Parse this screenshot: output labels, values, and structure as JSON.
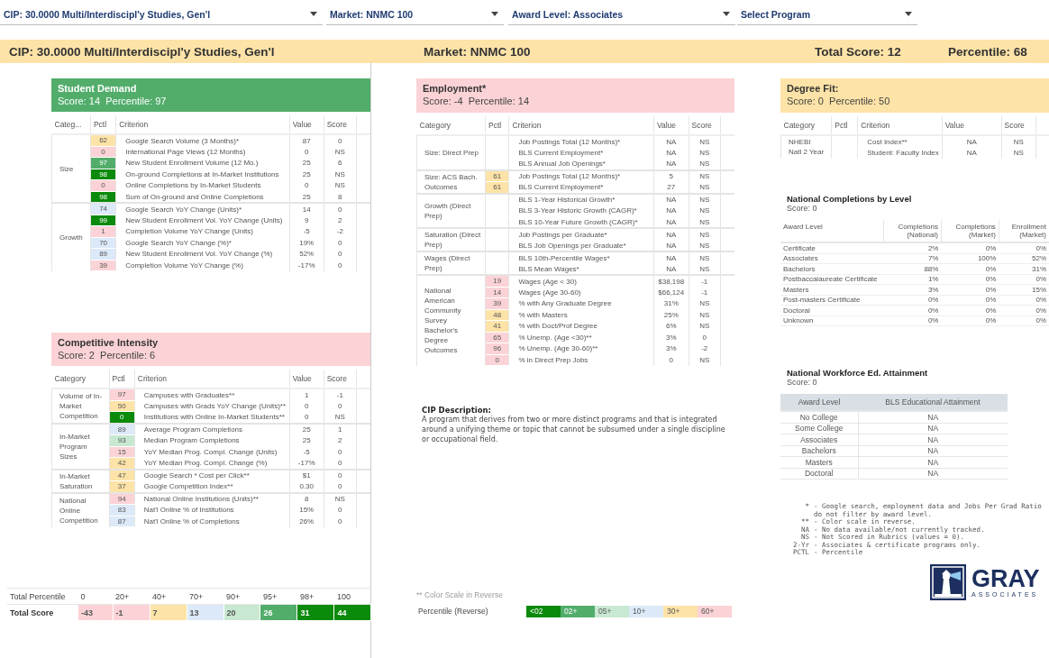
{
  "dropdowns": [
    {
      "label": "CIP: 30.0000 Multi/Interdiscipl'y Studies, Gen'l"
    },
    {
      "label": "Market: NNMC 100"
    },
    {
      "label": "Award Level: Associates"
    },
    {
      "label": "Select Program"
    }
  ],
  "summary": {
    "cip": "CIP: 30.0000 Multi/Interdiscipl'y Studies, Gen'l",
    "market": "Market: NNMC 100",
    "total_score": "Total Score: 12",
    "percentile": "Percentile: 68"
  },
  "panels": [
    {
      "title": "Student Demand",
      "subtitle": "Score: 14  Percentile: 97",
      "color": "#52ad6b",
      "columns": [
        "Categ...",
        "Pctl",
        "Criterion",
        "Value",
        "Score"
      ],
      "groups": [
        {
          "category": "Size",
          "rows": [
            {
              "pctl": "62",
              "color": "#fde3a7",
              "criterion": "Google Search Volume (3 Months)*",
              "value": "87",
              "score": "0"
            },
            {
              "pctl": "0",
              "color": "#fbd3d6",
              "criterion": "International Page Views (12 Months)",
              "value": "0",
              "score": "NS"
            },
            {
              "pctl": "97",
              "color": "#52ad6b",
              "criterion": "New Student Enrollment Volume (12 Mo.)",
              "value": "25",
              "score": "6"
            },
            {
              "pctl": "98",
              "color": "#0b8a0b",
              "criterion": "On-ground Completions at In-Market Institutions",
              "value": "25",
              "score": "NS"
            },
            {
              "pctl": "0",
              "color": "#fbd3d6",
              "criterion": "Online Completions by In-Market Students",
              "value": "0",
              "score": "NS"
            },
            {
              "pctl": "98",
              "color": "#0b8a0b",
              "criterion": "Sum of On-ground and Online Completions",
              "value": "25",
              "score": "8"
            }
          ]
        },
        {
          "category": "Growth",
          "rows": [
            {
              "pctl": "74",
              "color": "#dce9f8",
              "criterion": "Google Search YoY Change (Units)*",
              "value": "14",
              "score": "0"
            },
            {
              "pctl": "99",
              "color": "#0b8a0b",
              "criterion": "New Student Enrollment Vol. YoY Change (Units)",
              "value": "9",
              "score": "2"
            },
            {
              "pctl": "1",
              "color": "#fbd3d6",
              "criterion": "Completion Volume YoY Change (Units)",
              "value": "-5",
              "score": "-2"
            },
            {
              "pctl": "70",
              "color": "#dce9f8",
              "criterion": "Google Search YoY Change (%)*",
              "value": "19%",
              "score": "0"
            },
            {
              "pctl": "89",
              "color": "#dce9f8",
              "criterion": "New Student Enrollment Vol. YoY Change (%)",
              "value": "52%",
              "score": "0"
            },
            {
              "pctl": "39",
              "color": "#fbd3d6",
              "criterion": "Completion Volume YoY Change (%)",
              "value": "-17%",
              "score": "0"
            }
          ]
        }
      ]
    },
    {
      "title": "Competitive Intensity",
      "subtitle": "Score: 2  Percentile: 6",
      "color": "#fbd3d6",
      "columns": [
        "Category",
        "Pctl",
        "Criterion",
        "Value",
        "Score"
      ],
      "groups": [
        {
          "category": "Volume of In-Market Competition",
          "rows": [
            {
              "pctl": "97",
              "color": "#fbd3d6",
              "criterion": "Campuses with Graduates**",
              "value": "1",
              "score": "-1"
            },
            {
              "pctl": "50",
              "color": "#fde3a7",
              "criterion": "Campuses with Grads YoY Change (Units)**",
              "value": "0",
              "score": "0"
            },
            {
              "pctl": "0",
              "color": "#0b8a0b",
              "criterion": "Institutions with Online In-Market Students**",
              "value": "0",
              "score": "NS"
            }
          ]
        },
        {
          "category": "In-Market Program Sizes",
          "rows": [
            {
              "pctl": "89",
              "color": "#dce9f8",
              "criterion": "Average Program Completions",
              "value": "25",
              "score": "1"
            },
            {
              "pctl": "93",
              "color": "#c8e8d1",
              "criterion": "Median Program Completions",
              "value": "25",
              "score": "2"
            },
            {
              "pctl": "15",
              "color": "#fbd3d6",
              "criterion": "YoY Median Prog. Compl. Change (Units)",
              "value": "-5",
              "score": "0"
            },
            {
              "pctl": "42",
              "color": "#fde3a7",
              "criterion": "YoY Median Prog. Compl. Change (%)",
              "value": "-17%",
              "score": "0"
            }
          ]
        },
        {
          "category": "In-Market Saturation",
          "rows": [
            {
              "pctl": "47",
              "color": "#fde3a7",
              "criterion": "Google Search * Cost per Click**",
              "value": "$1",
              "score": "0"
            },
            {
              "pctl": "37",
              "color": "#fde3a7",
              "criterion": "Google Competition Index**",
              "value": "0.30",
              "score": "0"
            }
          ]
        },
        {
          "category": "National Online Competition",
          "rows": [
            {
              "pctl": "94",
              "color": "#fbd3d6",
              "criterion": "National Online Institutions (Units)**",
              "value": "8",
              "score": "NS"
            },
            {
              "pctl": "83",
              "color": "#dce9f8",
              "criterion": "Nat'l Online % of Institutions",
              "value": "15%",
              "score": "0"
            },
            {
              "pctl": "87",
              "color": "#dce9f8",
              "criterion": "Nat'l Online % of Completions",
              "value": "26%",
              "score": "0"
            }
          ]
        }
      ]
    },
    {
      "title": "Employment*",
      "subtitle": "Score: -4  Percentile: 14",
      "color": "#fbd3d6",
      "columns": [
        "Category",
        "Pctl",
        "Criterion",
        "Value",
        "Score"
      ],
      "groups": [
        {
          "category": "Size: Direct Prep",
          "rows": [
            {
              "criterion": "Job Postings Total (12 Months)*",
              "value": "NA",
              "score": "NS"
            },
            {
              "criterion": "BLS Current Employment*",
              "value": "NA",
              "score": "NS"
            },
            {
              "criterion": "BLS Annual Job Openings*",
              "value": "NA",
              "score": "NS"
            }
          ]
        },
        {
          "category": "Size: ACS Bach. Outcomes",
          "rows": [
            {
              "pctl": "61",
              "color": "#fde3a7",
              "criterion": "Job Postings Total (12 Months)*",
              "value": "5",
              "score": "NS"
            },
            {
              "pctl": "61",
              "color": "#fde3a7",
              "criterion": "BLS Current Employment*",
              "value": "27",
              "score": "NS"
            }
          ]
        },
        {
          "category": "Growth (Direct Prep)",
          "rows": [
            {
              "criterion": "BLS 1-Year Historical Growth*",
              "value": "NA",
              "score": "NS"
            },
            {
              "criterion": "BLS 3-Year Historic Growth (CAGR)*",
              "value": "NA",
              "score": "NS"
            },
            {
              "criterion": "BLS 10-Year Future Growth (CAGR)*",
              "value": "NA",
              "score": "NS"
            }
          ]
        },
        {
          "category": "Saturation (Direct Prep)",
          "rows": [
            {
              "criterion": "Job Postings per Graduate*",
              "value": "NA",
              "score": "NS"
            },
            {
              "criterion": "BLS Job Openings per Graduate*",
              "value": "NA",
              "score": "NS"
            }
          ]
        },
        {
          "category": "Wages (Direct Prep)",
          "rows": [
            {
              "criterion": "BLS 10th-Percentile Wages*",
              "value": "NA",
              "score": "NS"
            },
            {
              "criterion": "BLS Mean Wages*",
              "value": "NA",
              "score": "NS"
            }
          ]
        },
        {
          "category": "National American Community Survey Bachelor's Degree Outcomes",
          "rows": [
            {
              "pctl": "19",
              "color": "#fbd3d6",
              "criterion": "Wages (Age < 30)",
              "value": "$38,198",
              "score": "-1"
            },
            {
              "pctl": "14",
              "color": "#fbd3d6",
              "criterion": "Wages (Age 30-60)",
              "value": "$66,124",
              "score": "-1"
            },
            {
              "pctl": "39",
              "color": "#fbd3d6",
              "criterion": "% with Any Graduate Degree",
              "value": "31%",
              "score": "NS"
            },
            {
              "pctl": "48",
              "color": "#fde3a7",
              "criterion": "% with Masters",
              "value": "25%",
              "score": "NS"
            },
            {
              "pctl": "41",
              "color": "#fde3a7",
              "criterion": "% with Doct/Prof Degree",
              "value": "6%",
              "score": "NS"
            },
            {
              "pctl": "65",
              "color": "#fbd3d6",
              "criterion": "% Unemp. (Age <30)**",
              "value": "3%",
              "score": "0"
            },
            {
              "pctl": "96",
              "color": "#fbd3d6",
              "criterion": "% Unemp. (Age 30-60)**",
              "value": "3%",
              "score": "-2"
            },
            {
              "pctl": "0",
              "color": "#fbd3d6",
              "criterion": "% in Direct Prep Jobs",
              "value": "0",
              "score": "NS"
            }
          ]
        }
      ]
    },
    {
      "title": "Degree Fit:",
      "subtitle": "Score: 0  Percentile: 50",
      "color": "#fde3a7",
      "columns": [
        "Category",
        "Pctl",
        "Criterion",
        "Value",
        "Score"
      ],
      "groups": [
        {
          "category": "NHEBI\nNatl 2 Year",
          "rows": [
            {
              "criterion": "Cost Index**",
              "value": "NA",
              "score": "NS"
            },
            {
              "criterion": "Student: Faculty Index",
              "value": "NA",
              "score": "NS"
            }
          ]
        }
      ]
    }
  ],
  "totals": {
    "label": "Total Percentile",
    "levels": [
      "0",
      "20+",
      "40+",
      "70+",
      "90+",
      "95+",
      "98+",
      "100"
    ],
    "score_label": "Total Score",
    "scores": [
      {
        "text": "-43",
        "color": "#fbd3d6"
      },
      {
        "text": "-1",
        "color": "#fbd3d6"
      },
      {
        "text": "7",
        "color": "#fde3a7"
      },
      {
        "text": "13",
        "color": "#dce9f8"
      },
      {
        "text": "20",
        "color": "#c8e8d1"
      },
      {
        "text": "26",
        "color": "#52ad6b"
      },
      {
        "text": "31",
        "color": "#0b8a0b"
      },
      {
        "text": "44",
        "color": "#0b8a0b"
      }
    ]
  },
  "cip_description": {
    "title": "CIP Description:",
    "text": "A program that derives from two or more distinct programs and that is integrated around a unifying theme or topic that cannot be subsumed under a single discipline or occupational field."
  },
  "scale_note": "** Color Scale in Reverse",
  "reverse_scale": {
    "label": "Percentile (Reverse)",
    "cells": [
      {
        "text": "<02",
        "color": "#0b8a0b"
      },
      {
        "text": "02+",
        "color": "#52ad6b"
      },
      {
        "text": "05+",
        "color": "#c8e8d1"
      },
      {
        "text": "10+",
        "color": "#dce9f8"
      },
      {
        "text": "30+",
        "color": "#fde3a7"
      },
      {
        "text": "60+",
        "color": "#fbd3d6"
      }
    ]
  },
  "completions": {
    "title": "National Completions by Level",
    "subtitle": "Score: 0",
    "columns": [
      "Award Level",
      "Completions\n(National)",
      "Completions\n(Market)",
      "Enrollment\n(Market)"
    ],
    "rows": [
      [
        "Certificate",
        "2%",
        "0%",
        "0%"
      ],
      [
        "Associates",
        "7%",
        "100%",
        "52%"
      ],
      [
        "Bachelors",
        "88%",
        "0%",
        "31%"
      ],
      [
        "Postbaccalaureate Certificate",
        "1%",
        "0%",
        "0%"
      ],
      [
        "Masters",
        "3%",
        "0%",
        "15%"
      ],
      [
        "Post-masters Certificate",
        "0%",
        "0%",
        "0%"
      ],
      [
        "Doctoral",
        "0%",
        "0%",
        "0%"
      ],
      [
        "Unknown",
        "0%",
        "0%",
        "0%"
      ]
    ]
  },
  "workforce": {
    "title": "National Workforce Ed. Attainment",
    "subtitle": "Score: 0",
    "columns": [
      "Award Level",
      "BLS Educational Attainment"
    ],
    "rows": [
      [
        "No College",
        "NA"
      ],
      [
        "Some College",
        "NA"
      ],
      [
        "Associates",
        "NA"
      ],
      [
        "Bachelors",
        "NA"
      ],
      [
        "Masters",
        "NA"
      ],
      [
        "Doctoral",
        "NA"
      ]
    ]
  },
  "legend": [
    {
      "symbol": "*",
      "text": "- Google search, employment data and Jobs Per Grad Ratio do not filter by award level."
    },
    {
      "symbol": "**",
      "text": "- Color scale in reverse."
    },
    {
      "symbol": "NA",
      "text": "- No data available/not currently tracked."
    },
    {
      "symbol": "NS",
      "text": "- Not Scored in Rubrics (values = 0)."
    },
    {
      "symbol": "2-Yr",
      "text": "- Associates & certificate programs only."
    },
    {
      "symbol": "PCTL",
      "text": "- Percentile"
    }
  ],
  "logo": {
    "name": "GRAY",
    "tagline": "ASSOCIATES"
  }
}
